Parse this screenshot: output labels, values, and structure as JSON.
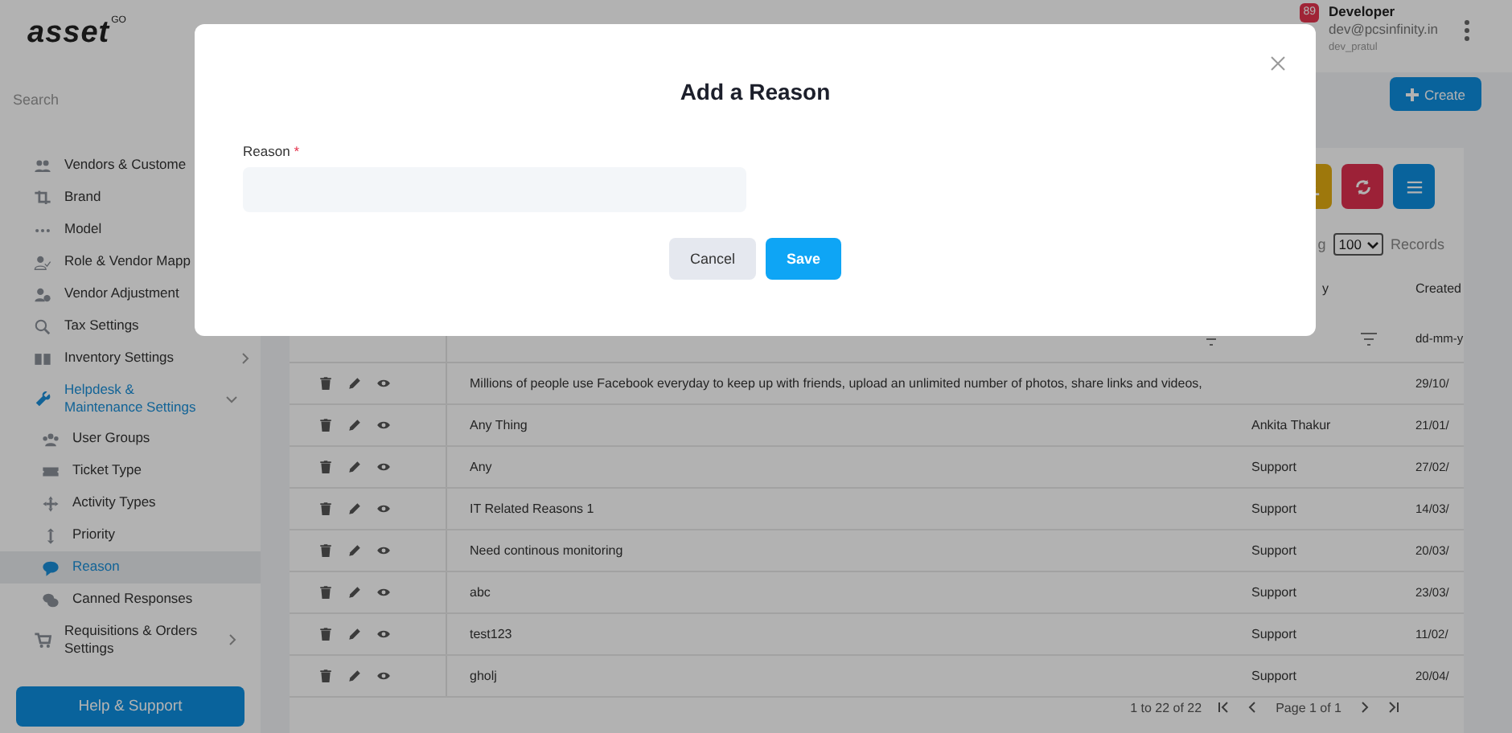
{
  "logo": {
    "text": "asset",
    "mark": "GO"
  },
  "sidebar": {
    "search": {
      "placeholder": "Search"
    },
    "items": [
      {
        "label": "Vendors & Custome",
        "selected": false
      },
      {
        "label": "Brand",
        "selected": false
      },
      {
        "label": "Model",
        "selected": false
      },
      {
        "label": "Role & Vendor Mapp",
        "selected": false
      },
      {
        "label": "Vendor Adjustment",
        "selected": false
      },
      {
        "label": "Tax Settings",
        "selected": false
      },
      {
        "label": "Inventory Settings",
        "selected": false,
        "expanded": false
      },
      {
        "label": "Helpdesk & Maintenance Settings",
        "selected": true,
        "expanded": true,
        "children": [
          {
            "label": "User Groups",
            "selected": false
          },
          {
            "label": "Ticket Type",
            "selected": false
          },
          {
            "label": "Activity Types",
            "selected": false
          },
          {
            "label": "Priority",
            "selected": false
          },
          {
            "label": "Reason",
            "selected": true
          },
          {
            "label": "Canned Responses",
            "selected": false
          }
        ]
      },
      {
        "label": "Requisitions & Orders Settings",
        "selected": false,
        "expanded": false
      }
    ],
    "help_button": "Help & Support"
  },
  "user": {
    "badge": "89",
    "name": "Developer",
    "email": "dev@pcsinfinity.in",
    "username": "dev_pratul"
  },
  "create_button": "Create",
  "table": {
    "showing": "g",
    "page_size": "100",
    "records": "Records",
    "columns": [
      {
        "label": "y"
      },
      {
        "label": "Created"
      }
    ],
    "date_filter": {
      "placeholder": "dd-mm-y"
    },
    "rows": [
      {
        "reason": "Millions of people use Facebook everyday to keep up with friends, upload an unlimited number of photos, share links and videos,",
        "created": "29/10/"
      },
      {
        "reason": "Any Thing",
        "created_by": "Ankita Thakur",
        "created": "21/01/"
      },
      {
        "reason": "Any",
        "created_by": "Support",
        "created": "27/02/"
      },
      {
        "reason": "IT Related Reasons 1",
        "created_by": "Support",
        "created": "14/03/"
      },
      {
        "reason": "Need continous monitoring",
        "created_by": "Support",
        "created": "20/03/"
      },
      {
        "reason": "abc",
        "created_by": "Support",
        "created": "23/03/"
      },
      {
        "reason": "test123",
        "created_by": "Support",
        "created": "11/02/"
      },
      {
        "reason": "gholj",
        "created_by": "Support",
        "created": "20/04/"
      }
    ],
    "footer": {
      "range": "1 to 22 of 22",
      "page": "Page 1 of 1"
    }
  },
  "modal": {
    "title": "Add a Reason",
    "field": {
      "label": "Reason",
      "required_mark": "*"
    },
    "buttons": [
      {
        "label": "Cancel",
        "kind": "secondary"
      },
      {
        "label": "Save",
        "kind": "primary"
      }
    ]
  }
}
